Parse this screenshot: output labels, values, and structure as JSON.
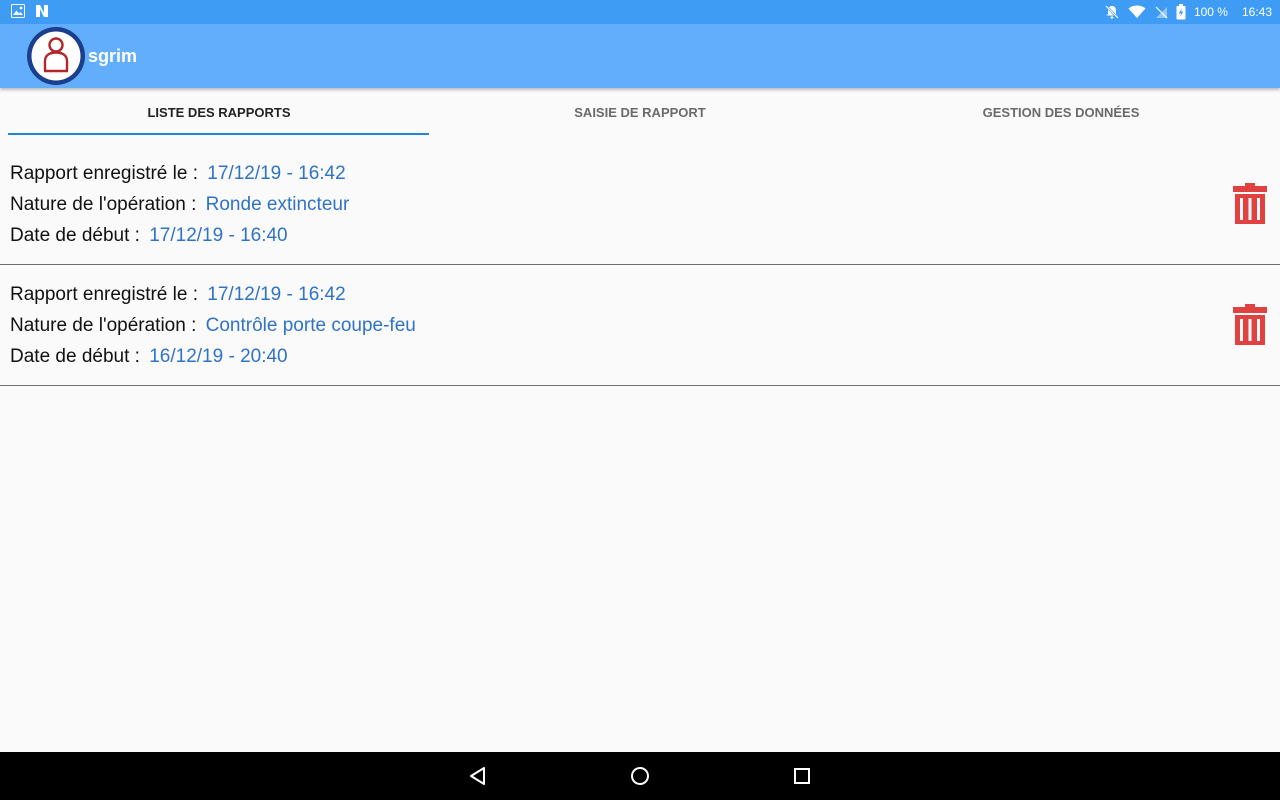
{
  "status_bar": {
    "battery": "100 %",
    "time": "16:43",
    "left_icons": [
      "gallery-icon",
      "n-logo-icon"
    ],
    "right_icons": [
      "bell-off-icon",
      "wifi-icon",
      "no-sim-icon",
      "battery-charging-icon"
    ]
  },
  "app_bar": {
    "title": "sgrim",
    "logo_icon": "user-avatar-icon"
  },
  "tabs": [
    {
      "label": "LISTE DES RAPPORTS",
      "active": true
    },
    {
      "label": "SAISIE DE RAPPORT",
      "active": false
    },
    {
      "label": "GESTION DES DONNÉES",
      "active": false
    }
  ],
  "reports": [
    {
      "saved_label": "Rapport enregistré le :",
      "saved_value": "17/12/19 - 16:42",
      "nature_label": "Nature de l'opération :",
      "nature_value": "Ronde extincteur",
      "start_label": "Date de début :",
      "start_value": "17/12/19 - 16:40",
      "action_icon": "trash-icon"
    },
    {
      "saved_label": "Rapport enregistré le :",
      "saved_value": "17/12/19 - 16:42",
      "nature_label": "Nature de l'opération :",
      "nature_value": "Contrôle porte coupe-feu",
      "start_label": "Date de début :",
      "start_value": "16/12/19 - 20:40",
      "action_icon": "trash-icon"
    }
  ],
  "nav_bar": {
    "buttons": [
      "back-icon",
      "home-icon",
      "recents-icon"
    ]
  },
  "colors": {
    "status_bar": "#3f9cf5",
    "app_bar": "#62aefc",
    "tab_indicator": "#1f88d0",
    "value_text": "#2f73c6",
    "delete_icon": "#e04141",
    "background": "#fafafa"
  }
}
